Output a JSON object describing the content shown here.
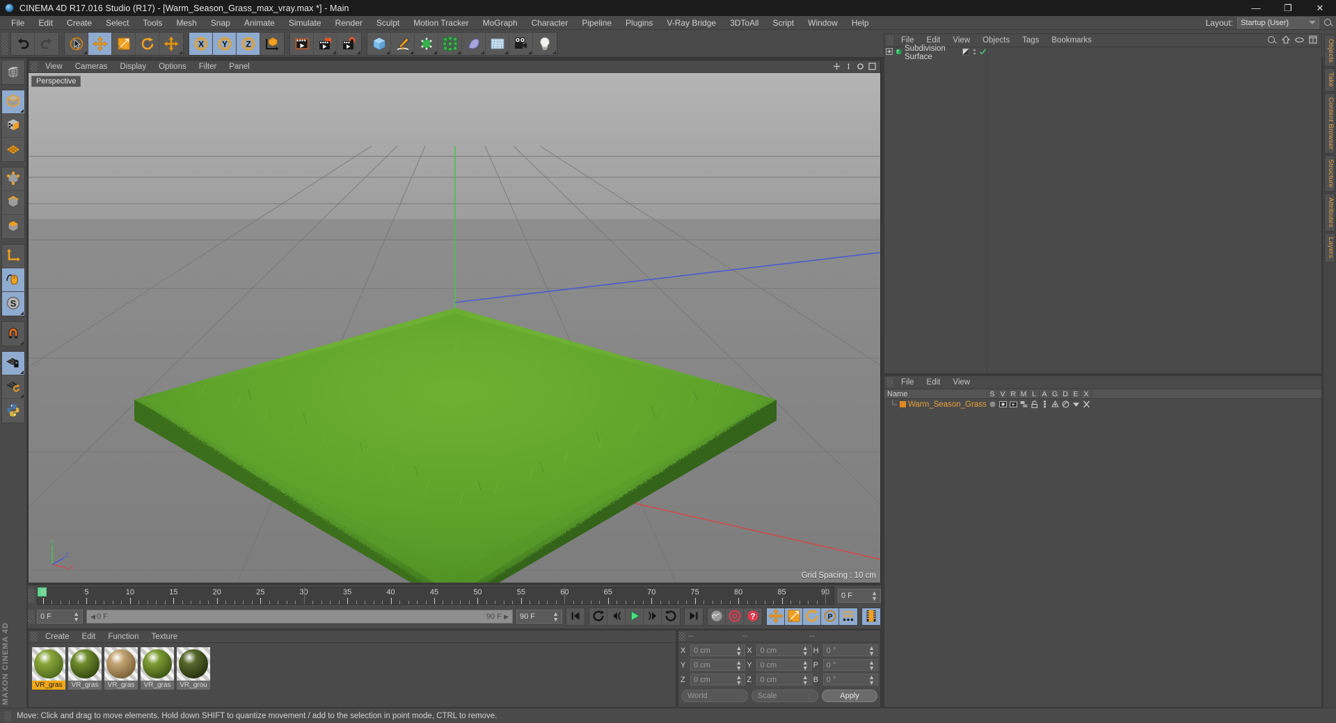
{
  "window": {
    "title": "CINEMA 4D R17.016 Studio (R17) - [Warm_Season_Grass_max_vray.max *] - Main",
    "minimize": "—",
    "maximize": "❐",
    "close": "✕"
  },
  "menubar": {
    "items": [
      "File",
      "Edit",
      "Create",
      "Select",
      "Tools",
      "Mesh",
      "Snap",
      "Animate",
      "Simulate",
      "Render",
      "Sculpt",
      "Motion Tracker",
      "MoGraph",
      "Character",
      "Pipeline",
      "Plugins",
      "V-Ray Bridge",
      "3DToAll",
      "Script",
      "Window",
      "Help"
    ],
    "layout_label": "Layout:",
    "layout_value": "Startup (User)",
    "search_icon": "search-icon"
  },
  "toolbar": {
    "groups": [
      {
        "name": "history",
        "buttons": [
          {
            "name": "undo-button",
            "icon": "undo-icon",
            "active": false,
            "corner": false
          },
          {
            "name": "redo-button",
            "icon": "redo-icon",
            "active": false,
            "corner": false
          }
        ]
      },
      {
        "name": "transform",
        "buttons": [
          {
            "name": "live-selection-tool",
            "icon": "cursor-circle-icon",
            "active": false,
            "corner": true
          },
          {
            "name": "move-tool",
            "icon": "move-arrows-icon",
            "active": true,
            "corner": false
          },
          {
            "name": "scale-tool",
            "icon": "scale-box-icon",
            "active": false,
            "corner": false
          },
          {
            "name": "rotate-tool",
            "icon": "rotate-icon",
            "active": false,
            "corner": false
          },
          {
            "name": "move-variant-tool",
            "icon": "move-arrows-icon",
            "active": false,
            "corner": true
          }
        ]
      },
      {
        "name": "axis-lock",
        "buttons": [
          {
            "name": "lock-x-axis",
            "icon": "x-axis-icon",
            "active": true,
            "corner": false
          },
          {
            "name": "lock-y-axis",
            "icon": "y-axis-icon",
            "active": true,
            "corner": false
          },
          {
            "name": "lock-z-axis",
            "icon": "z-axis-icon",
            "active": true,
            "corner": false
          },
          {
            "name": "world-object-coordinates",
            "icon": "world-axis-cube-icon",
            "active": false,
            "corner": false
          }
        ]
      },
      {
        "name": "render",
        "buttons": [
          {
            "name": "render-view-button",
            "icon": "render-view-icon",
            "active": false,
            "corner": false
          },
          {
            "name": "render-to-picture-viewer-button",
            "icon": "render-picture-icon",
            "active": false,
            "corner": true
          },
          {
            "name": "edit-render-settings-button",
            "icon": "render-settings-icon",
            "active": false,
            "corner": true
          }
        ]
      },
      {
        "name": "create",
        "buttons": [
          {
            "name": "add-cube-object",
            "icon": "cube-icon",
            "active": false,
            "corner": true
          },
          {
            "name": "add-spline-pen",
            "icon": "pen-spline-icon",
            "active": false,
            "corner": true
          },
          {
            "name": "add-generator",
            "icon": "generator-icon",
            "active": false,
            "corner": true
          },
          {
            "name": "add-mograph-object",
            "icon": "mograph-cloner-icon",
            "active": false,
            "corner": true
          },
          {
            "name": "add-deformer",
            "icon": "deformer-icon",
            "active": false,
            "corner": true
          },
          {
            "name": "add-scene-environment",
            "icon": "floor-grid-icon",
            "active": false,
            "corner": true
          },
          {
            "name": "add-camera",
            "icon": "camera-icon",
            "active": false,
            "corner": true
          },
          {
            "name": "add-light",
            "icon": "light-bulb-icon",
            "active": false,
            "corner": true
          }
        ]
      }
    ]
  },
  "left_toolbar": {
    "groups": [
      {
        "buttons": [
          {
            "name": "undo-view-tool",
            "icon": "globe-grid-icon",
            "active": false,
            "corner": false
          }
        ]
      },
      {
        "buttons": [
          {
            "name": "model-mode",
            "icon": "model-cube-icon",
            "active": true,
            "corner": true
          },
          {
            "name": "texture-mode",
            "icon": "texture-cube-icon",
            "active": false,
            "corner": false
          },
          {
            "name": "workplane-mode",
            "icon": "workplane-icon",
            "active": false,
            "corner": false
          }
        ]
      },
      {
        "buttons": [
          {
            "name": "points-mode",
            "icon": "points-cube-icon",
            "active": false,
            "corner": false
          },
          {
            "name": "edges-mode",
            "icon": "edges-cube-icon",
            "active": false,
            "corner": false
          },
          {
            "name": "polygons-mode",
            "icon": "polygons-cube-icon",
            "active": false,
            "corner": false
          }
        ]
      },
      {
        "buttons": [
          {
            "name": "enable-axis-modification",
            "icon": "axis-l-icon",
            "active": false,
            "corner": false
          },
          {
            "name": "enable-soft-interaction",
            "icon": "mouse-soft-icon",
            "active": true,
            "corner": false
          },
          {
            "name": "soft-selection-tool",
            "icon": "s-sphere-icon",
            "active": true,
            "corner": true
          }
        ]
      },
      {
        "buttons": [
          {
            "name": "enable-snapping",
            "icon": "magnet-icon",
            "active": false,
            "corner": true
          }
        ]
      },
      {
        "buttons": [
          {
            "name": "lock-workplane",
            "icon": "grid-lock-icon",
            "active": true,
            "corner": true
          },
          {
            "name": "planar-workplane",
            "icon": "grid-rotate-icon",
            "active": false,
            "corner": true
          },
          {
            "name": "python-script",
            "icon": "python-icon",
            "active": false,
            "corner": false
          }
        ]
      }
    ],
    "brand_top": "MAXON",
    "brand_bottom": "CINEMA 4D"
  },
  "viewport": {
    "menu": [
      "View",
      "Cameras",
      "Display",
      "Options",
      "Filter",
      "Panel"
    ],
    "camera_label": "Perspective",
    "grid_spacing": "Grid Spacing : 10 cm",
    "axis_labels": {
      "x": "X",
      "y": "Y",
      "z": "Z"
    },
    "corner_icons": [
      "move-view-icon",
      "scale-view-icon",
      "rotate-view-icon",
      "maximize-view-icon"
    ]
  },
  "timeline": {
    "ticks": [
      0,
      5,
      10,
      15,
      20,
      25,
      30,
      35,
      40,
      45,
      50,
      55,
      60,
      65,
      70,
      75,
      80,
      85,
      90
    ],
    "current_frame": "0 F",
    "end_frame_field": "90 F",
    "preview_min": "0 F",
    "preview_max": "90 F",
    "frame_field_right": "0 F",
    "transport": [
      {
        "name": "go-to-start-button",
        "icon": "skip-start-icon",
        "active": false
      },
      {
        "name": "go-to-previous-keyframe-button",
        "icon": "prev-key-icon",
        "active": false
      },
      {
        "name": "step-back-button",
        "icon": "step-back-icon",
        "active": false
      },
      {
        "name": "play-button",
        "icon": "play-icon",
        "active": false
      },
      {
        "name": "step-forward-button",
        "icon": "step-forward-icon",
        "active": false
      },
      {
        "name": "go-to-next-keyframe-button",
        "icon": "next-key-icon",
        "active": false
      },
      {
        "name": "go-to-end-button",
        "icon": "skip-end-icon",
        "active": false
      }
    ],
    "record_group": [
      {
        "name": "autokeying-toggle",
        "icon": "key-icon",
        "active": false
      },
      {
        "name": "record-active-objects-button",
        "icon": "record-circle-icon",
        "active": false
      },
      {
        "name": "keyframe-selection-button",
        "icon": "question-circle-icon",
        "active": false
      }
    ],
    "key_filters": [
      {
        "name": "position-key-toggle",
        "icon": "move-arrows-icon",
        "active": true
      },
      {
        "name": "scale-key-toggle",
        "icon": "scale-box-icon",
        "active": true
      },
      {
        "name": "rotation-key-toggle",
        "icon": "rotate-icon",
        "active": true
      },
      {
        "name": "parameter-key-toggle",
        "icon": "p-circle-icon",
        "active": true
      },
      {
        "name": "point-level-animation-toggle",
        "icon": "dots-grid-icon",
        "active": true
      }
    ],
    "filmstrip": {
      "name": "timeline-filmstrip-button",
      "icon": "filmstrip-icon",
      "active": true
    }
  },
  "material_manager": {
    "menu": [
      "Create",
      "Edit",
      "Function",
      "Texture"
    ],
    "materials": [
      {
        "name": "VR_gras",
        "selected": true,
        "color_a": "#8aa53a",
        "color_b": "#4e6b1c"
      },
      {
        "name": "VR_gras",
        "selected": false,
        "color_a": "#6f8c2c",
        "color_b": "#33480f"
      },
      {
        "name": "VR_gras",
        "selected": false,
        "color_a": "#c3a474",
        "color_b": "#7a5f36"
      },
      {
        "name": "VR_gras",
        "selected": false,
        "color_a": "#7d9b33",
        "color_b": "#3c5414"
      },
      {
        "name": "VR_grou",
        "selected": false,
        "color_a": "#56682c",
        "color_b": "#26300f"
      }
    ]
  },
  "coordinates": {
    "header": [
      "--",
      "--",
      "--"
    ],
    "rows": [
      {
        "pos_label": "X",
        "pos_value": "0 cm",
        "size_label": "X",
        "size_value": "0 cm",
        "rot_label": "H",
        "rot_value": "0 °"
      },
      {
        "pos_label": "Y",
        "pos_value": "0 cm",
        "size_label": "Y",
        "size_value": "0 cm",
        "rot_label": "P",
        "rot_value": "0 °"
      },
      {
        "pos_label": "Z",
        "pos_value": "0 cm",
        "size_label": "Z",
        "size_value": "0 cm",
        "rot_label": "B",
        "rot_value": "0 °"
      }
    ],
    "system_select": "World",
    "mode_select": "Scale",
    "apply_label": "Apply"
  },
  "object_manager": {
    "menu": [
      "File",
      "Edit",
      "View",
      "Objects",
      "Tags",
      "Bookmarks"
    ],
    "icons": [
      "search-icon",
      "home-icon",
      "eye-icon",
      "frame-icon"
    ],
    "items": [
      {
        "label": "Subdivision Surface",
        "icon": "subdivision-surface-icon",
        "expandable": true,
        "checked": true
      }
    ]
  },
  "layer_manager": {
    "menu": [
      "File",
      "Edit",
      "View"
    ],
    "columns": [
      "Name",
      "S",
      "V",
      "R",
      "M",
      "L",
      "A",
      "G",
      "D",
      "E",
      "X"
    ],
    "rows": [
      {
        "name": "Warm_Season_Grass",
        "swatch": "#e08a1e"
      }
    ]
  },
  "right_tabs": [
    "Objects",
    "Take",
    "Content Browser",
    "Structure",
    "Attributes",
    "Layers"
  ],
  "status_bar": {
    "text": "Move: Click and drag to move elements. Hold down SHIFT to quantize movement / add to the selection in point mode, CTRL to remove."
  },
  "colors": {
    "accent_orange": "#f0a818",
    "active_blue": "#8fabcf",
    "panel_bg": "#4a4a4a",
    "titlebar_bg": "#1b1b1b",
    "grass_green": "#4f8f22"
  }
}
